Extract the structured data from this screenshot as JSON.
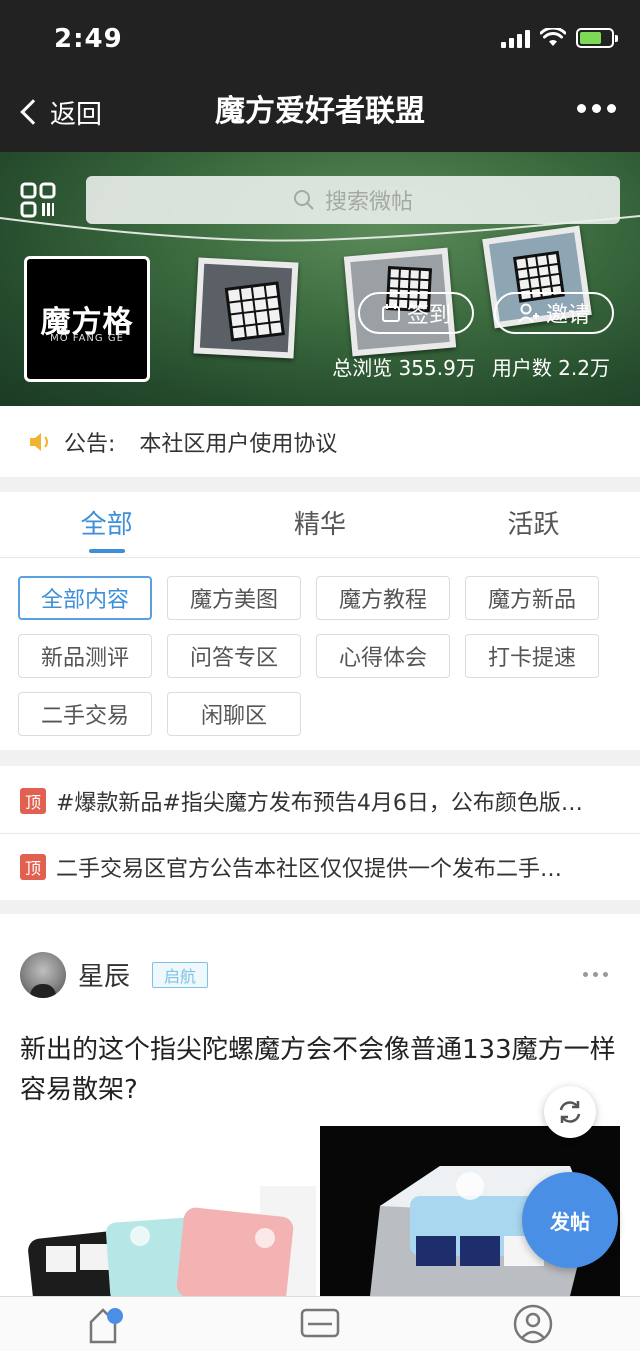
{
  "status_bar": {
    "time": "2:49"
  },
  "nav": {
    "back_label": "返回",
    "title": "魔方爱好者联盟"
  },
  "banner": {
    "search_placeholder": "搜索微帖",
    "logo_main": "魔方格",
    "logo_sub": "MO FANG GE",
    "sign_in_label": "签到",
    "invite_label": "邀请",
    "views_text": "总浏览 355.9万",
    "users_text": "用户数 2.2万"
  },
  "notice": {
    "label": "公告:",
    "text": "本社区用户使用协议"
  },
  "tabs": [
    {
      "label": "全部",
      "active": true
    },
    {
      "label": "精华",
      "active": false
    },
    {
      "label": "活跃",
      "active": false
    }
  ],
  "chips": [
    {
      "label": "全部内容",
      "active": true
    },
    {
      "label": "魔方美图"
    },
    {
      "label": "魔方教程"
    },
    {
      "label": "魔方新品"
    },
    {
      "label": "新品测评"
    },
    {
      "label": "问答专区"
    },
    {
      "label": "心得体会"
    },
    {
      "label": "打卡提速"
    },
    {
      "label": "二手交易"
    },
    {
      "label": "闲聊区"
    }
  ],
  "pinned": [
    {
      "badge": "顶",
      "text": "#爆款新品#指尖魔方发布预告4月6日，公布颜色版…"
    },
    {
      "badge": "顶",
      "text": "二手交易区官方公告本社区仅仅提供一个发布二手…"
    }
  ],
  "post": {
    "author": "星辰",
    "level": "启航",
    "title": "新出的这个指尖陀螺魔方会不会像普通133魔方一样容易散架?"
  },
  "fab": {
    "post_label": "发帖"
  },
  "colors": {
    "accent": "#3d8fd9",
    "top_badge": "#e2604f",
    "fab": "#4a8fe6",
    "status_bg": "#222222"
  },
  "icons": {
    "qr": "qr-code-icon",
    "search": "search-icon",
    "sign": "calendar-icon",
    "invite": "add-user-icon",
    "speaker": "speaker-icon",
    "refresh": "refresh-icon",
    "home": "home-icon",
    "message": "message-icon",
    "profile": "profile-icon"
  }
}
